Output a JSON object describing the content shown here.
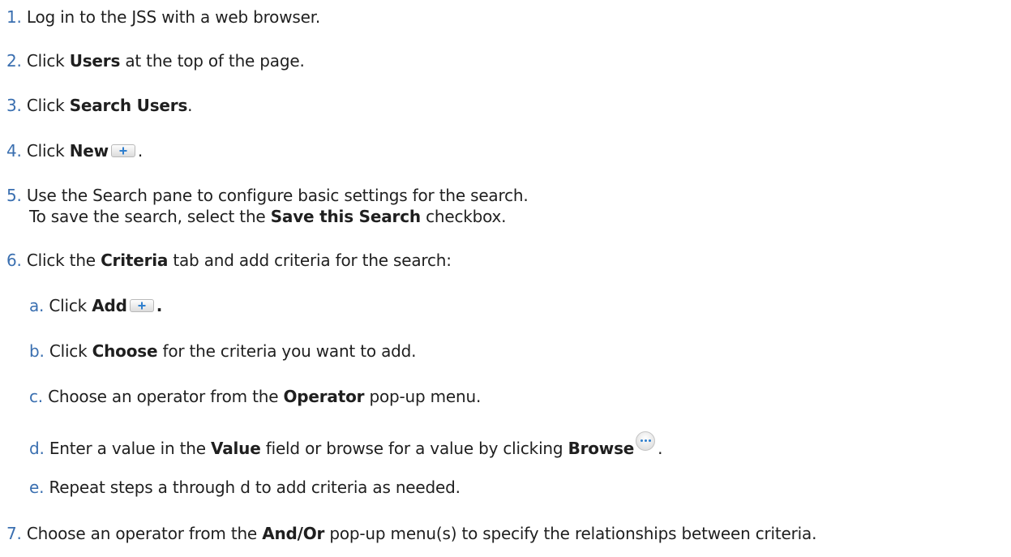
{
  "steps": [
    {
      "num": "1.",
      "text": "Log in to the JSS with a web browser."
    },
    {
      "num": "2.",
      "pre": "Click ",
      "bold": "Users",
      "post": " at the top of the page."
    },
    {
      "num": "3.",
      "pre": "Click ",
      "bold": "Search Users",
      "post": "."
    },
    {
      "num": "4.",
      "pre": "Click ",
      "bold": "New",
      "post": "."
    },
    {
      "num": "5.",
      "text": "Use the Search pane to configure basic settings for the search.",
      "line2_pre": "To save the search, select the ",
      "line2_bold": "Save this Search",
      "line2_post": " checkbox."
    },
    {
      "num": "6.",
      "pre": "Click the ",
      "bold": "Criteria",
      "post": " tab and add criteria for the search:"
    },
    {
      "num": "7.",
      "pre": "Choose an operator from the ",
      "bold": "And/Or",
      "post": " pop-up menu(s) to specify the relationships between criteria."
    }
  ],
  "substeps": [
    {
      "num": "a.",
      "pre": "Click ",
      "bold": "Add",
      "post": "."
    },
    {
      "num": "b.",
      "pre": "Click ",
      "bold": "Choose",
      "post": " for the criteria you want to add."
    },
    {
      "num": "c.",
      "pre": "Choose an operator from the ",
      "bold": "Operator",
      "post": " pop-up menu."
    },
    {
      "num": "d.",
      "pre": "Enter a value in the ",
      "bold": "Value",
      "mid": " field or browse for a value by clicking ",
      "bold2": "Browse",
      "post": "."
    },
    {
      "num": "e.",
      "text": "Repeat steps a through d to add criteria as needed."
    }
  ],
  "icons": {
    "add": "plus-button-icon",
    "browse": "ellipsis-button-icon"
  }
}
